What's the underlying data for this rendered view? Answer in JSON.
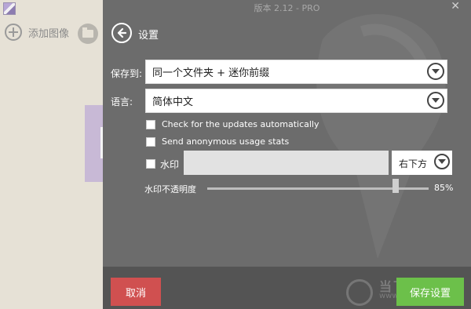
{
  "window": {
    "title": "版本 2.12 - PRO",
    "close_glyph": "✕"
  },
  "left": {
    "add_image_label": "添加图像"
  },
  "settings": {
    "title": "设置",
    "save_to_label": "保存到:",
    "save_to_value": "同一个文件夹 + 迷你前缀",
    "language_label": "语言:",
    "language_value": "简体中文",
    "check_updates_label": "Check for the updates automatically",
    "send_usage_label": "Send anonymous usage stats",
    "watermark_label": "水印",
    "watermark_text_value": "",
    "watermark_position_value": "右下方",
    "opacity_label": "水印不透明度",
    "opacity_value_text": "85%",
    "opacity_value": 85
  },
  "footer": {
    "cancel_label": "取消",
    "save_label": "保存设置",
    "watermark_brand": "当下软件园",
    "watermark_url": "www.downxia.com"
  },
  "colors": {
    "panel_bg": "#6c6c6c",
    "footer_bg": "#545454",
    "cancel": "#d05050",
    "save": "#6cc04a"
  }
}
